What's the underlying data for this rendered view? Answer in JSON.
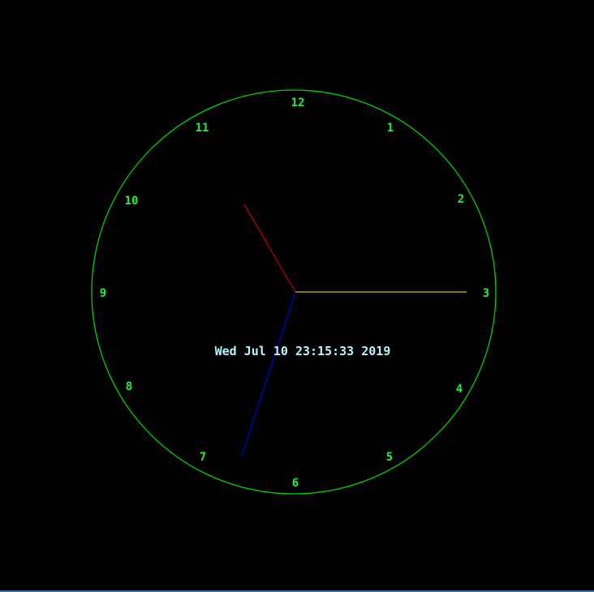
{
  "clock": {
    "numerals": [
      "12",
      "1",
      "2",
      "3",
      "4",
      "5",
      "6",
      "7",
      "8",
      "9",
      "10",
      "11"
    ],
    "datetime_text": "Wed Jul 10 23:15:33 2019",
    "time": {
      "hours": 23,
      "minutes": 15,
      "seconds": 33
    }
  },
  "colors": {
    "background": "#000000",
    "dial": "#00d000",
    "numerals": "#22ee44",
    "hour_hand": "#cc0000",
    "minute_hand": "#c8c800",
    "second_hand": "#0000dd",
    "datetime_text": "#b8f4ff",
    "bottom_border": "#3a6ea5"
  }
}
